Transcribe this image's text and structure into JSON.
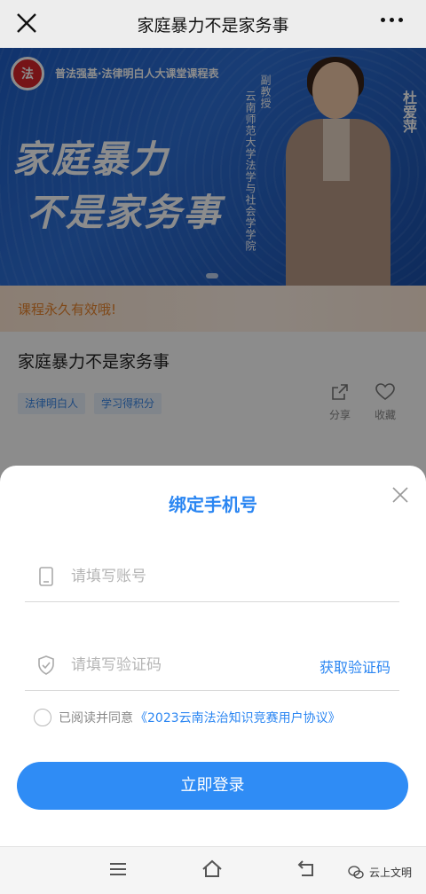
{
  "nav": {
    "title": "家庭暴力不是家务事"
  },
  "banner": {
    "logo_text": "法",
    "series": "普法强基·法律明白人大课堂课程表",
    "headline_1": "家庭暴力",
    "headline_2": "不是家务事",
    "speaker_title": "副教授",
    "speaker_org": "云南师范大学法学与社会学学院",
    "speaker_name": "杜爱萍"
  },
  "validity_note": "课程永久有效哦!",
  "course": {
    "title": "家庭暴力不是家务事",
    "tags": [
      "法律明白人",
      "学习得积分"
    ],
    "share_label": "分享",
    "favorite_label": "收藏"
  },
  "modal": {
    "title": "绑定手机号",
    "account_placeholder": "请填写账号",
    "code_placeholder": "请填写验证码",
    "get_code_label": "获取验证码",
    "agree_text": "已阅读并同意",
    "agreement_link": "《2023云南法治知识竞赛用户协议》",
    "login_button": "立即登录"
  },
  "watermark": "云上文明",
  "colors": {
    "accent": "#2f8cf5",
    "tag_text": "#3a87e6",
    "validity_text": "#e8842d",
    "banner_blue": "#1f5fc7"
  },
  "icons": [
    "close-icon",
    "more-icon",
    "share-icon",
    "heart-icon",
    "phone-icon",
    "shield-icon",
    "menu-icon",
    "home-icon",
    "back-icon",
    "wechat-icon"
  ]
}
